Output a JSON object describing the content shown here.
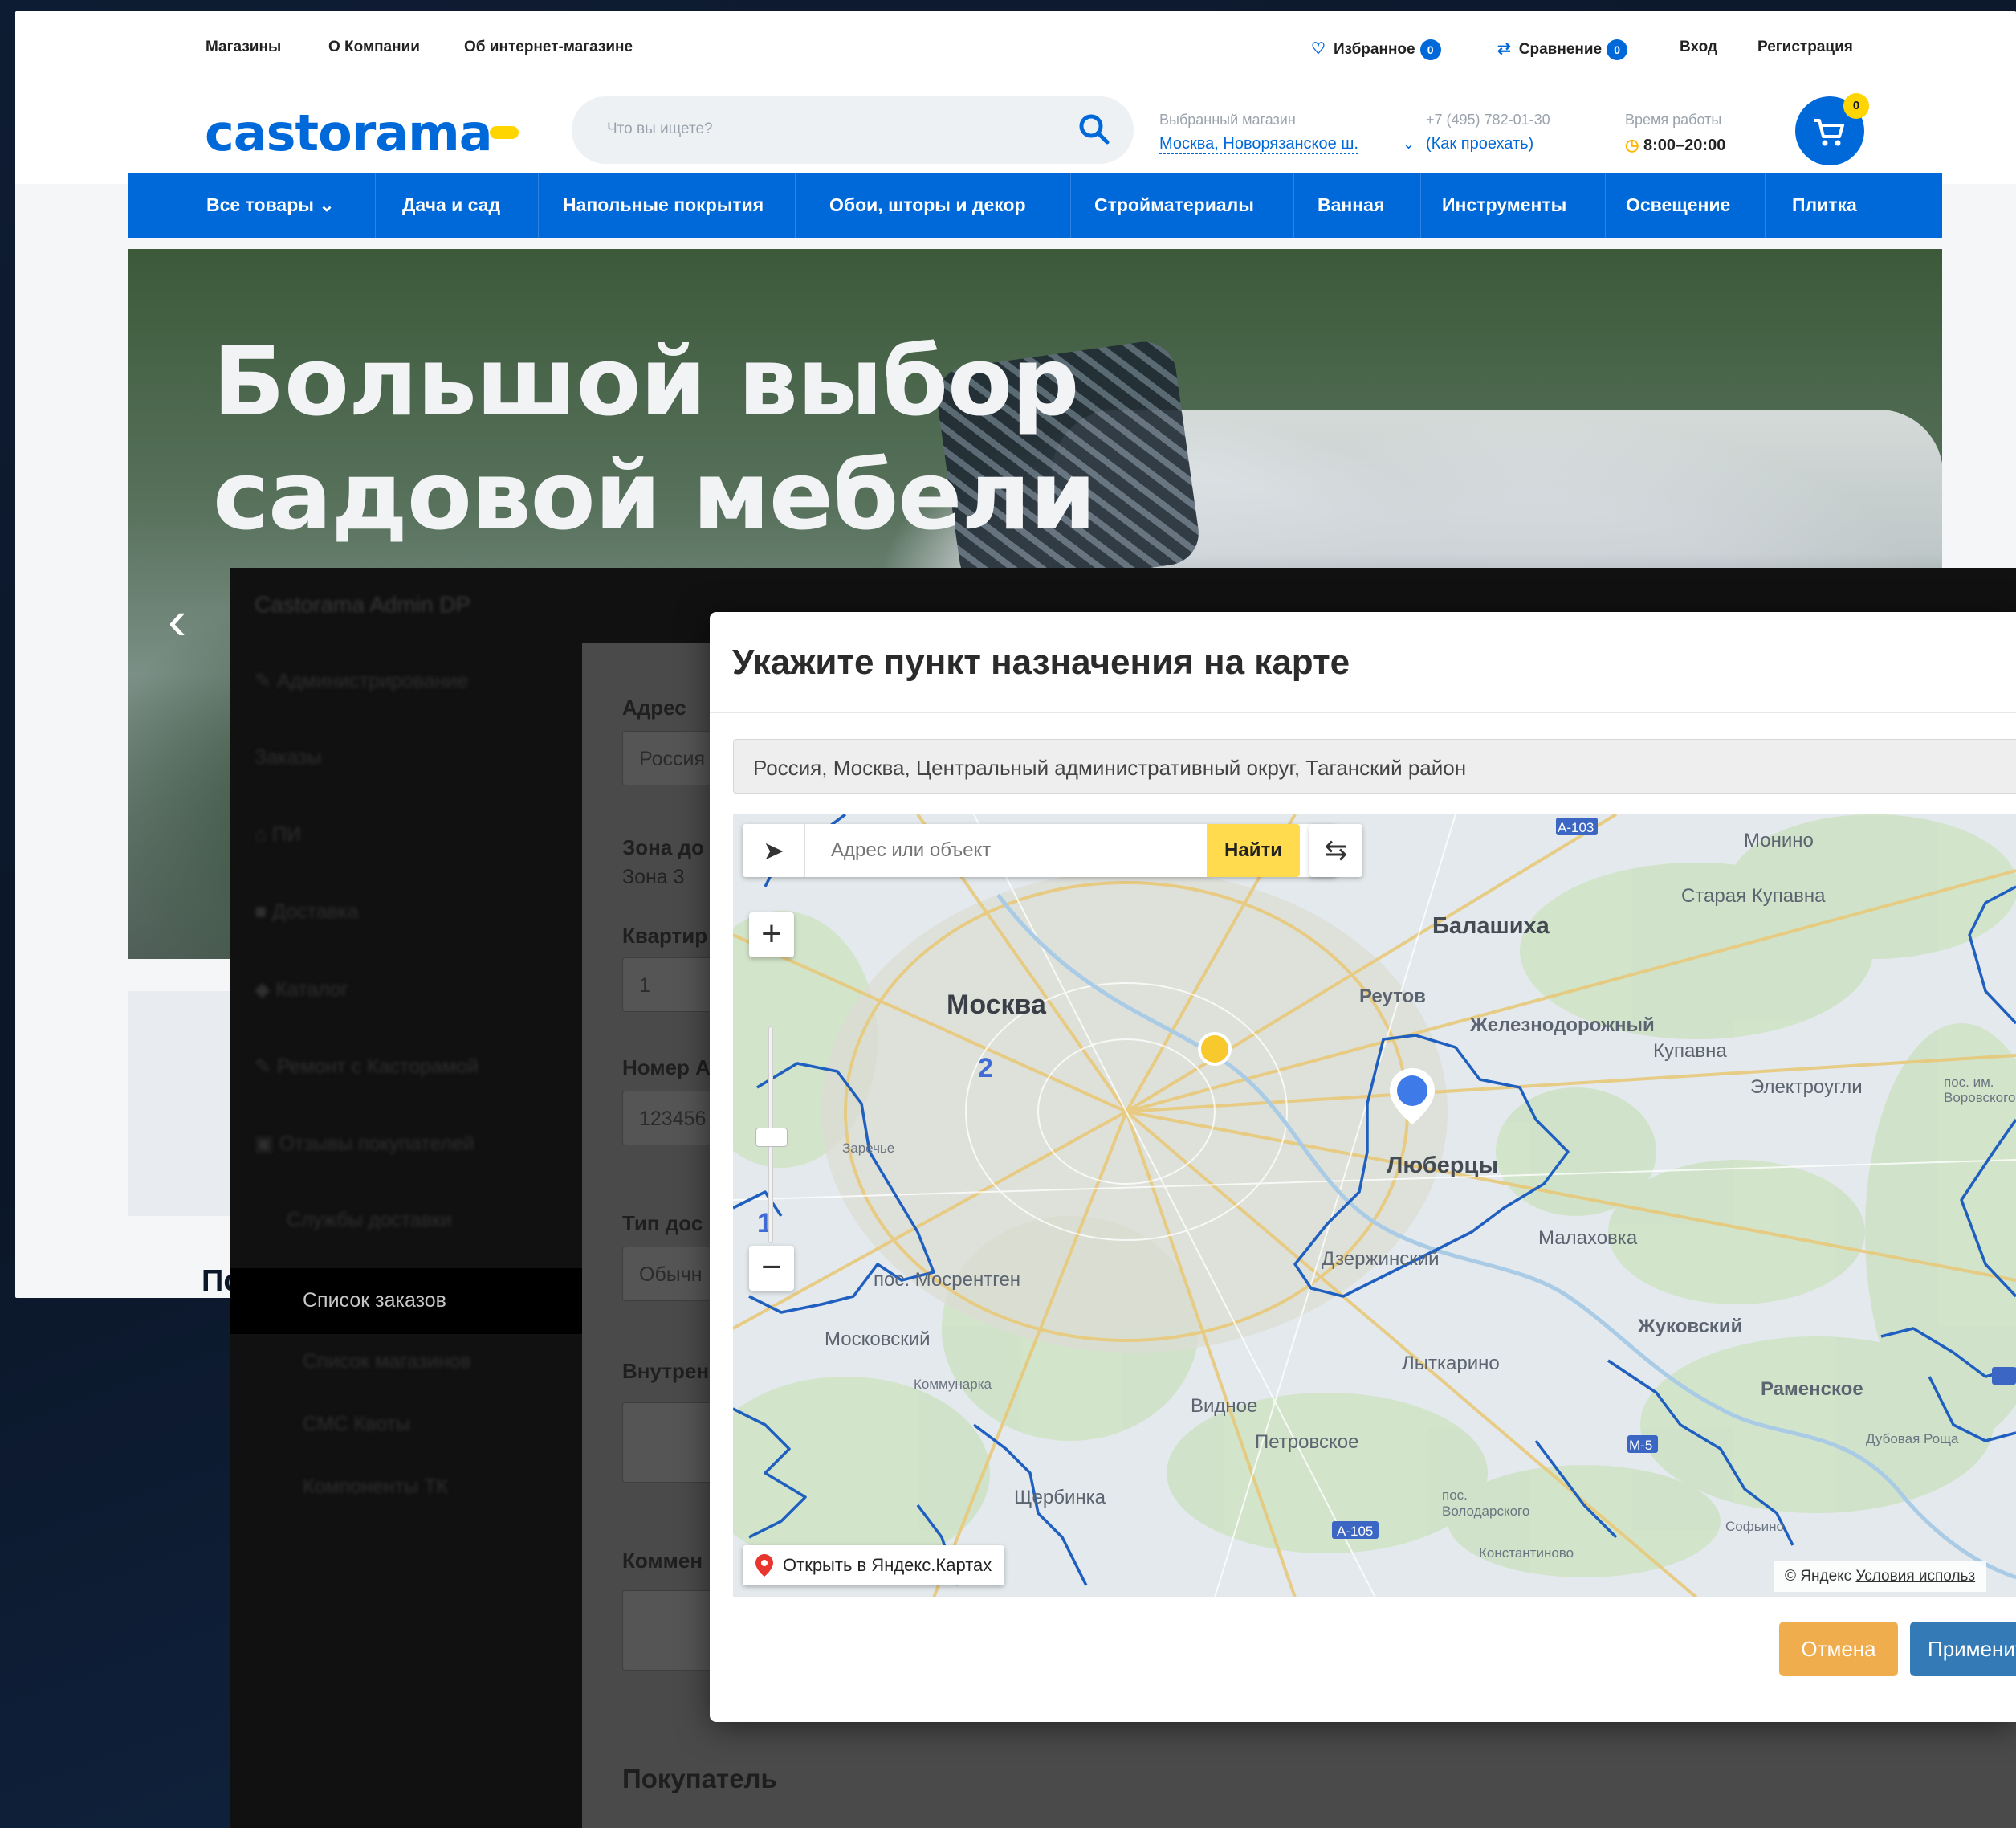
{
  "store": {
    "top_links": [
      "Магазины",
      "О Компании",
      "Об интернет-магазине"
    ],
    "favorites": {
      "label": "Избранное",
      "count": "0"
    },
    "compare": {
      "label": "Сравнение",
      "count": "0"
    },
    "login": "Вход",
    "register": "Регистрация",
    "logo": "castorama",
    "search_placeholder": "Что вы ищете?",
    "selected_shop_label": "Выбранный магазин",
    "selected_shop_value": "Москва, Новорязанское ш.",
    "phone": "+7 (495) 782-01-30",
    "directions": "(Как проехать)",
    "hours_label": "Время работы",
    "hours_value": "8:00–20:00",
    "cart_count": "0",
    "nav": [
      "Все товары",
      "Дача и сад",
      "Напольные покрытия",
      "Обои, шторы и декор",
      "Стройматериалы",
      "Ванная",
      "Инструменты",
      "Освещение",
      "Плитка"
    ],
    "hero_title_line1": "Большой выбор",
    "hero_title_line2": "садовой мебели",
    "cut_text": "По"
  },
  "admin": {
    "title": "Castorama Admin DP",
    "sidebar_blurred": [
      "Администрирование",
      "Заказы",
      "ПИ",
      "Доставка",
      "Каталог",
      "Ремонт с Касторамой",
      "Отзывы покупателей",
      "Службы доставки"
    ],
    "sidebar_active": "Список заказов",
    "sidebar_below": [
      "Список магазинов",
      "СМС Квоты",
      "Компоненты ТК"
    ],
    "form": {
      "address_label": "Адрес",
      "address_value": "Россия",
      "zone_label": "Зона до",
      "zone_value": "Зона 3",
      "apartment_label": "Квартир",
      "apartment_value": "1",
      "number_label": "Номер А",
      "number_value": "123456",
      "delivery_type_label": "Тип дос",
      "delivery_type_value": "Обычн",
      "internal_label": "Внутрен",
      "comment_label": "Коммен",
      "buyer_heading": "Покупатель"
    }
  },
  "modal": {
    "title": "Укажите пункт назначения на карте",
    "address": "Россия, Москва, Центральный административный округ, Таганский район",
    "map": {
      "search_placeholder": "Адрес или объект",
      "find_button": "Найти",
      "open_yandex": "Открыть в Яндекс.Картах",
      "copyright": "© Яндекс",
      "terms": "Условия использ",
      "labels": {
        "moscow": "Москва",
        "balashikha": "Балашиха",
        "reutov": "Реутов",
        "zhel": "Железнодорожный",
        "kupavna": "Купавна",
        "monino": "Монино",
        "staraya_kupavna": "Старая Купавна",
        "elektrougli": "Электроугли",
        "lyubertsy": "Люберцы",
        "malakhovka": "Малаховка",
        "dzerzhinsky": "Дзержинский",
        "zhukovsky": "Жуковский",
        "lytkarino": "Лыткарино",
        "ramenskoe": "Раменское",
        "vidnoe": "Видное",
        "petrovskoe": "Петровское",
        "shcherbinka": "Щербинка",
        "moskovsky": "Московский",
        "kommunarka": "Коммунарка",
        "mosrentgen": "пос. Мосрентген",
        "zarechye": "Заречье",
        "dubovaya": "Дубовая Роща",
        "sofyino": "Софьино",
        "volodarsk": "пос. Володарского",
        "konstantinovo": "Константиново",
        "vorovsk": "пос. им. Воровского",
        "district_2": "2",
        "district_1": "1",
        "road_a103": "А-103",
        "road_a105": "А-105",
        "road_m5": "М-5"
      }
    },
    "cancel": "Отмена",
    "apply": "Применить"
  },
  "colors": {
    "castorama_blue": "#0069d9",
    "castorama_yellow": "#ffd500",
    "yandex_yellow": "#ffdb4d",
    "cancel_orange": "#f0ad4e",
    "apply_blue": "#337ab7",
    "boundary_blue": "#1f5fbf"
  }
}
